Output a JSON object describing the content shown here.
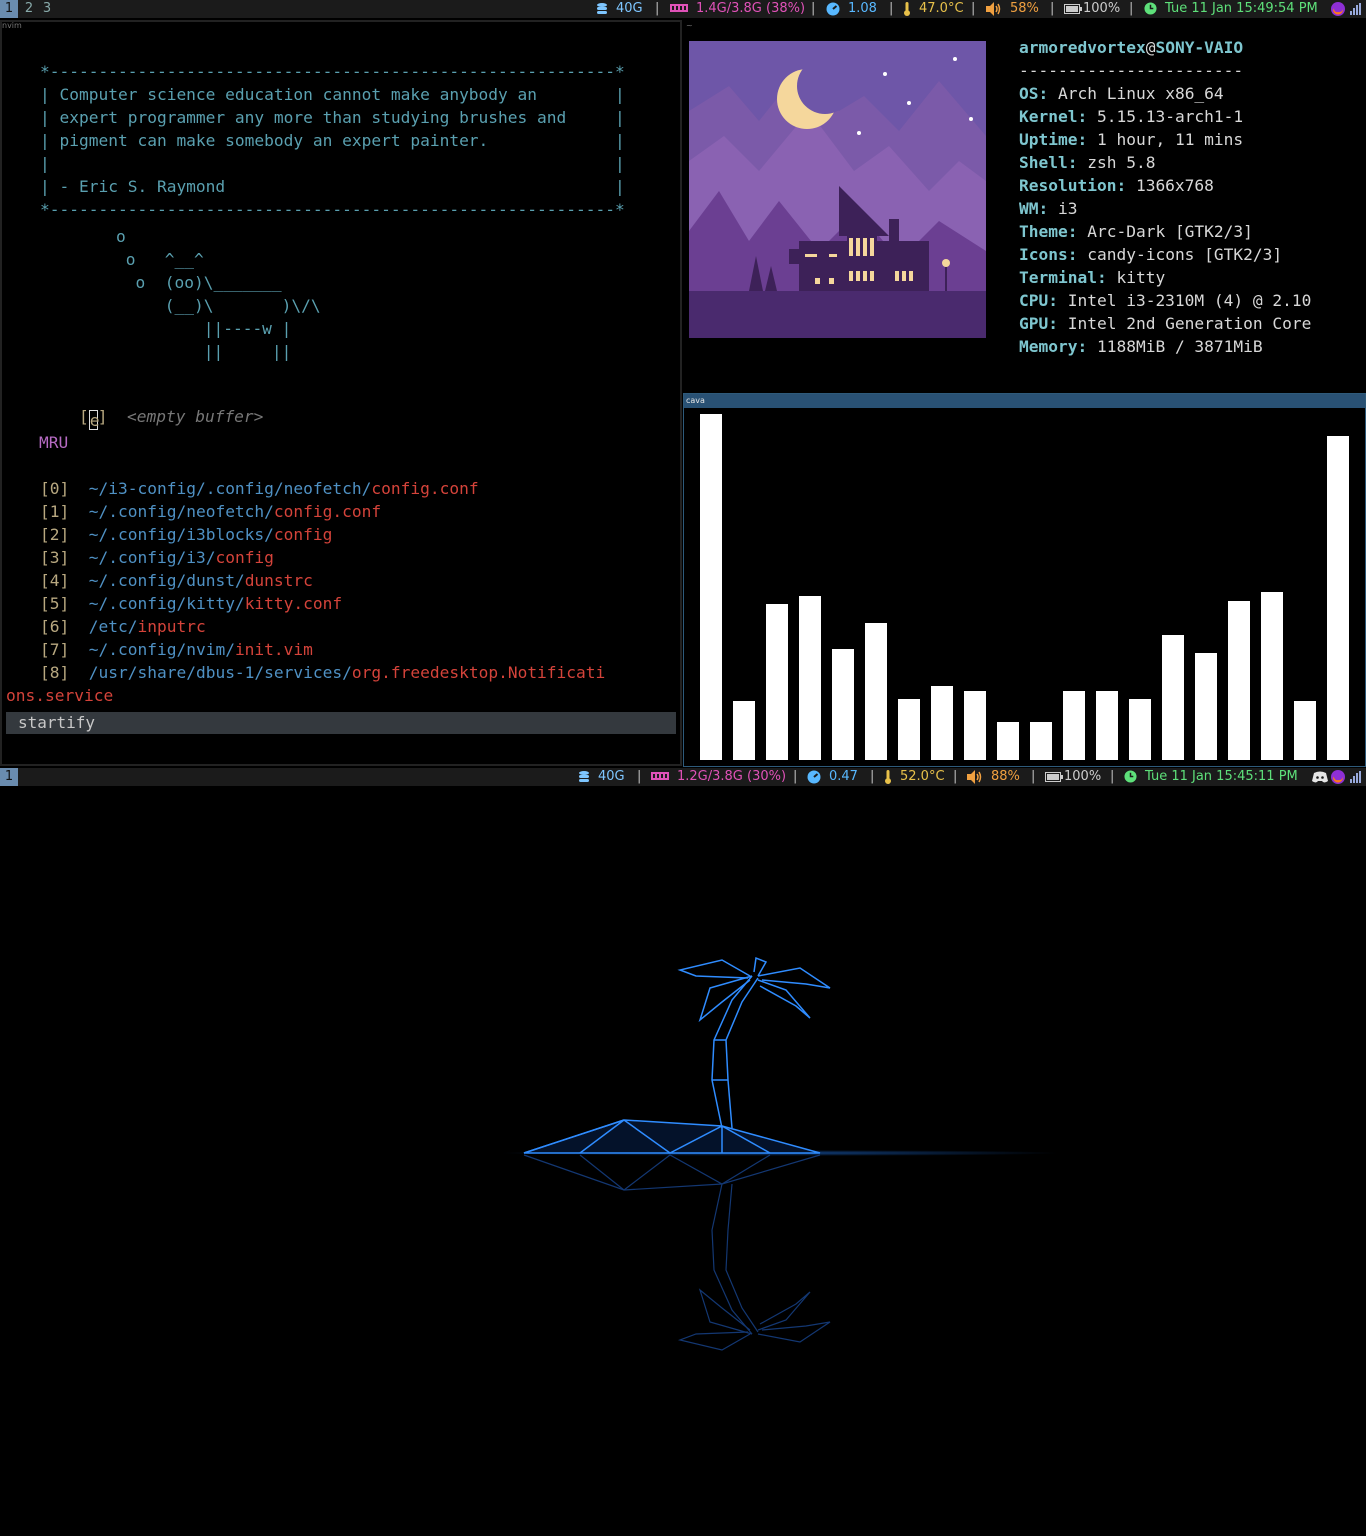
{
  "top_bar": {
    "workspaces": [
      "1",
      "2",
      "3"
    ],
    "disk": "40G",
    "memory": "1.4G/3.8G (38%)",
    "load": "1.08",
    "temp": "47.0°C",
    "volume": "58%",
    "battery": "100%",
    "datetime": "Tue 11 Jan 15:49:54 PM"
  },
  "bottom_bar": {
    "workspaces": [
      "1"
    ],
    "disk": "40G",
    "memory": "1.2G/3.8G (30%)",
    "load": "0.47",
    "temp": "52.0°C",
    "volume": "88%",
    "battery": "100%",
    "datetime": "Tue 11 Jan 15:45:11 PM"
  },
  "separator": "|",
  "windows": {
    "nvim_title": "nvim",
    "kitty_title": "~",
    "cava_title": "cava"
  },
  "nvim": {
    "quote_lines": [
      "*----------------------------------------------------------*",
      "| Computer science education cannot make anybody an        |",
      "| expert programmer any more than studying brushes and     |",
      "| pigment can make somebody an expert painter.             |",
      "|                                                          |",
      "| - Eric S. Raymond                                        |",
      "*----------------------------------------------------------*"
    ],
    "cow_lines": [
      "o",
      " o   ^__^",
      "  o  (oo)\\_______",
      "     (__)\\       )\\/\\",
      "         ||----w |",
      "         ||     ||"
    ],
    "empty_key": "e",
    "empty_label": "<empty buffer>",
    "mru_header": "MRU",
    "mru": [
      {
        "idx": "[0]",
        "dir": "~/i3-config/.config/neofetch/",
        "file": "config.conf"
      },
      {
        "idx": "[1]",
        "dir": "~/.config/neofetch/",
        "file": "config.conf"
      },
      {
        "idx": "[2]",
        "dir": "~/.config/i3blocks/",
        "file": "config"
      },
      {
        "idx": "[3]",
        "dir": "~/.config/i3/",
        "file": "config"
      },
      {
        "idx": "[4]",
        "dir": "~/.config/dunst/",
        "file": "dunstrc"
      },
      {
        "idx": "[5]",
        "dir": "~/.config/kitty/",
        "file": "kitty.conf"
      },
      {
        "idx": "[6]",
        "dir": "/etc/",
        "file": "inputrc"
      },
      {
        "idx": "[7]",
        "dir": "~/.config/nvim/",
        "file": "init.vim"
      },
      {
        "idx": "[8]",
        "dir": "/usr/share/dbus-1/services/",
        "file": "org.freedesktop.Notificati"
      }
    ],
    "wrap_line": "ons.service",
    "statusline": "startify"
  },
  "neofetch": {
    "user": "armoredvortex",
    "at": "@",
    "host": "SONY-VAIO",
    "rule": "-----------------------",
    "info": [
      {
        "key": "OS",
        "value": "Arch Linux x86_64"
      },
      {
        "key": "Kernel",
        "value": "5.15.13-arch1-1"
      },
      {
        "key": "Uptime",
        "value": "1 hour, 11 mins"
      },
      {
        "key": "Shell",
        "value": "zsh 5.8"
      },
      {
        "key": "Resolution",
        "value": "1366x768"
      },
      {
        "key": "WM",
        "value": "i3"
      },
      {
        "key": "Theme",
        "value": "Arc-Dark [GTK2/3]"
      },
      {
        "key": "Icons",
        "value": "candy-icons [GTK2/3]"
      },
      {
        "key": "Terminal",
        "value": "kitty"
      },
      {
        "key": "CPU",
        "value": "Intel i3-2310M (4) @ 2.10"
      },
      {
        "key": "GPU",
        "value": "Intel 2nd Generation Core"
      },
      {
        "key": "Memory",
        "value": "1188MiB / 3871MiB"
      }
    ]
  },
  "cava": {
    "levels": [
      1.0,
      0.17,
      0.45,
      0.475,
      0.32,
      0.395,
      0.175,
      0.215,
      0.2,
      0.11,
      0.11,
      0.2,
      0.2,
      0.175,
      0.36,
      0.31,
      0.46,
      0.485,
      0.17,
      0.935
    ]
  },
  "colors": {
    "disk": "#7ec6ff",
    "memory": "#e052b8",
    "load": "#58b8ff",
    "temp": "#e8c14a",
    "volume": "#f0a040",
    "battery": "#cccccc",
    "clock": "#5ee07a",
    "accent": "#295174"
  },
  "icons": [
    "database-icon",
    "ram-icon",
    "gauge-icon",
    "thermometer-icon",
    "speaker-icon",
    "battery-icon",
    "clock-icon",
    "firefox-icon",
    "discord-icon",
    "signal-icon"
  ]
}
